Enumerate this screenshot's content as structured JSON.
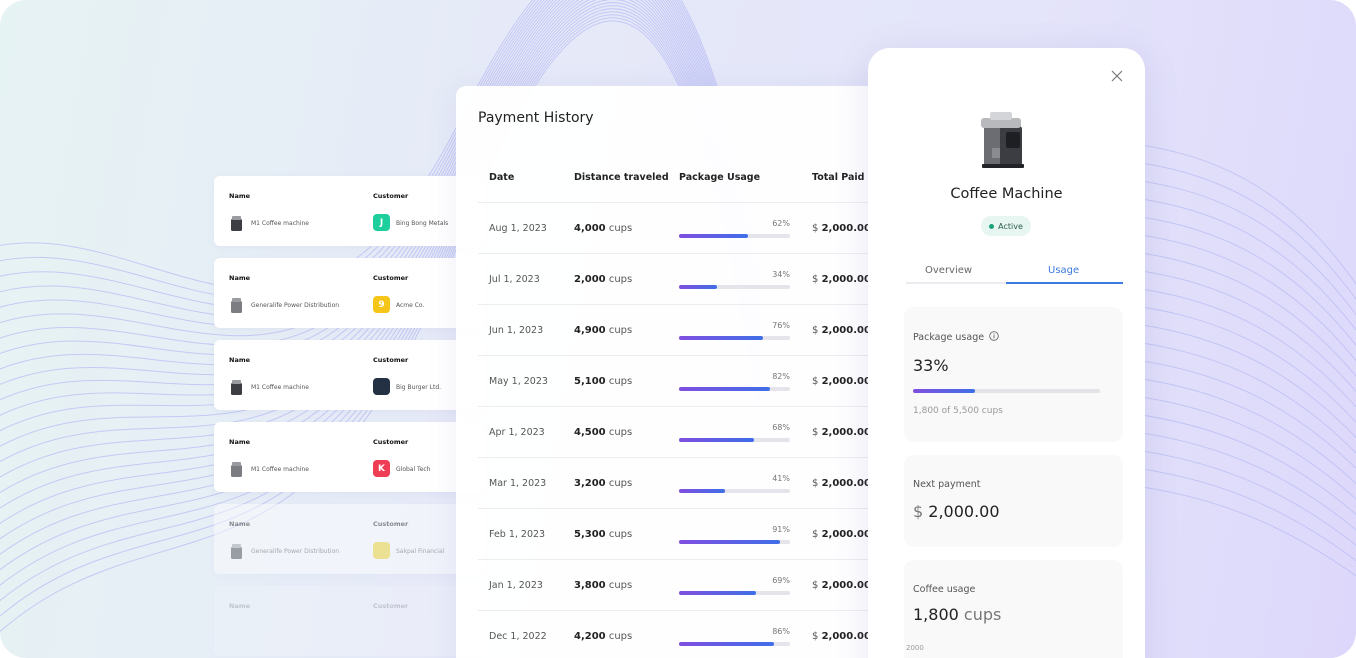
{
  "cards": {
    "name_header": "Name",
    "customer_header": "Customer",
    "items": [
      {
        "name": "M1 Coffee machine",
        "customer": "Bing Bong Metals",
        "logo_char": "J",
        "logo_color": "#1ccf9c"
      },
      {
        "name": "Generalife Power Distribution",
        "customer": "Acme Co.",
        "logo_char": "9",
        "logo_color": "#f5c518"
      },
      {
        "name": "M1 Coffee machine",
        "customer": "Big Burger Ltd.",
        "logo_char": "",
        "logo_color": "#243044"
      },
      {
        "name": "M1 Coffee machine",
        "customer": "Global Tech",
        "logo_char": "K",
        "logo_color": "#ee3d54"
      },
      {
        "name": "Generalife Power Distribution",
        "customer": "Sakpal Financial",
        "logo_char": "",
        "logo_color": "#f5d318"
      }
    ]
  },
  "payment_history": {
    "title": "Payment History",
    "columns": [
      "Date",
      "Distance traveled",
      "Package Usage",
      "Total Paid"
    ],
    "rows": [
      {
        "date": "Aug 1, 2023",
        "cups_num": "4,000",
        "cups_unit": "cups",
        "pct": "62%",
        "pct_value": 62,
        "currency": "$",
        "amount": "2,000.00"
      },
      {
        "date": "Jul 1, 2023",
        "cups_num": "2,000",
        "cups_unit": "cups",
        "pct": "34%",
        "pct_value": 34,
        "currency": "$",
        "amount": "2,000.00"
      },
      {
        "date": "Jun 1, 2023",
        "cups_num": "4,900",
        "cups_unit": "cups",
        "pct": "76%",
        "pct_value": 76,
        "currency": "$",
        "amount": "2,000.00"
      },
      {
        "date": "May 1, 2023",
        "cups_num": "5,100",
        "cups_unit": "cups",
        "pct": "82%",
        "pct_value": 82,
        "currency": "$",
        "amount": "2,000.00"
      },
      {
        "date": "Apr 1, 2023",
        "cups_num": "4,500",
        "cups_unit": "cups",
        "pct": "68%",
        "pct_value": 68,
        "currency": "$",
        "amount": "2,000.00"
      },
      {
        "date": "Mar 1, 2023",
        "cups_num": "3,200",
        "cups_unit": "cups",
        "pct": "41%",
        "pct_value": 41,
        "currency": "$",
        "amount": "2,000.00"
      },
      {
        "date": "Feb 1, 2023",
        "cups_num": "5,300",
        "cups_unit": "cups",
        "pct": "91%",
        "pct_value": 91,
        "currency": "$",
        "amount": "2,000.00"
      },
      {
        "date": "Jan 1, 2023",
        "cups_num": "3,800",
        "cups_unit": "cups",
        "pct": "69%",
        "pct_value": 69,
        "currency": "$",
        "amount": "2,000.00"
      },
      {
        "date": "Dec 1, 2022",
        "cups_num": "4,200",
        "cups_unit": "cups",
        "pct": "86%",
        "pct_value": 86,
        "currency": "$",
        "amount": "2,000.00"
      }
    ]
  },
  "detail": {
    "title": "Coffee Machine",
    "status": "Active",
    "tabs": [
      "Overview",
      "Usage"
    ],
    "active_tab": "Usage",
    "package_usage": {
      "label": "Package usage",
      "value": "33%",
      "value_num": 33,
      "sub": "1,800 of 5,500 cups"
    },
    "next_payment": {
      "label": "Next payment",
      "currency": "$",
      "amount": "2,000.00"
    },
    "coffee_usage": {
      "label": "Coffee usage",
      "value": "1,800",
      "unit": "cups"
    },
    "axis_label": "2000"
  },
  "colors": {
    "accent_blue": "#3d7be0",
    "bar_start": "#7f4fe0",
    "bar_end": "#3f6ee8",
    "status_green": "#1aa37a"
  },
  "icons": {
    "close": "close-icon",
    "info": "info-icon",
    "product": "coffee-machine-icon"
  }
}
